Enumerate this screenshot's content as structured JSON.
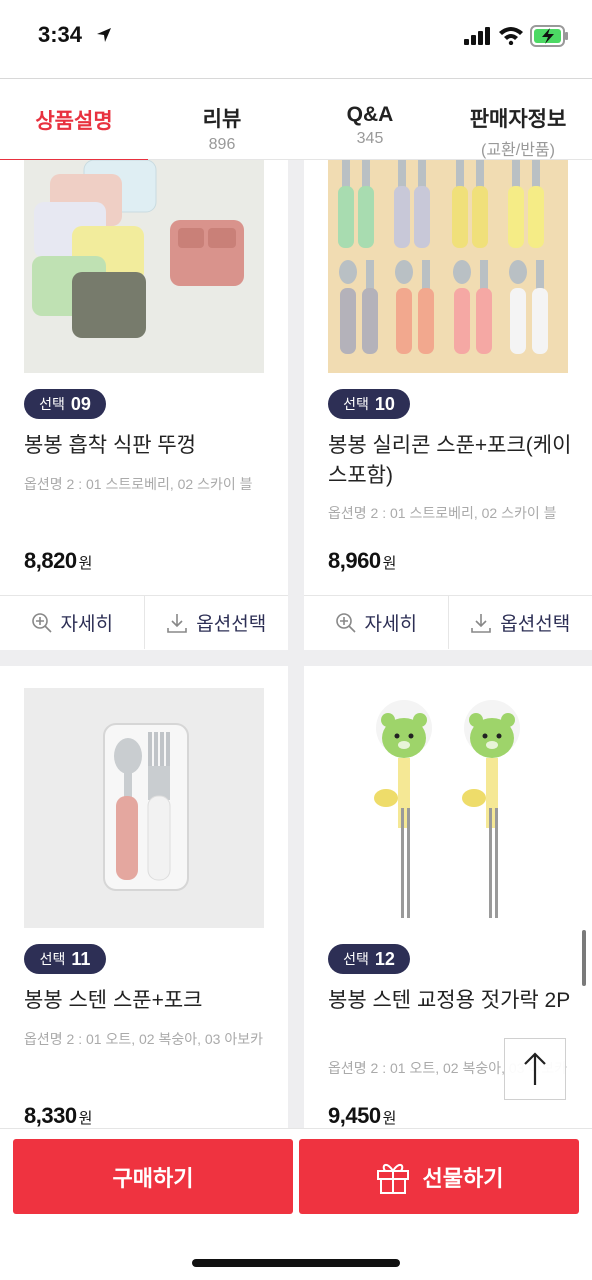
{
  "status": {
    "time": "3:34"
  },
  "tabs": [
    {
      "label": "상품설명",
      "sub": ""
    },
    {
      "label": "리뷰",
      "sub": "896"
    },
    {
      "label": "Q&A",
      "sub": "345"
    },
    {
      "label": "판매자정보",
      "sub": "(교환/반품)"
    }
  ],
  "products": [
    {
      "badge_label": "선택",
      "badge_num": "09",
      "name": "봉봉 흡착 식판 뚜껑",
      "options": "옵션명 2 : 01 스트로베리, 02 스카이 블",
      "price": "8,820",
      "currency": "원"
    },
    {
      "badge_label": "선택",
      "badge_num": "10",
      "name": "봉봉 실리콘 스푼+포크(케이스포함)",
      "options": "옵션명 2 : 01 스트로베리, 02 스카이 블",
      "price": "8,960",
      "currency": "원"
    },
    {
      "badge_label": "선택",
      "badge_num": "11",
      "name": "봉봉 스텐 스푼+포크",
      "options": "옵션명 2 : 01 오트, 02 복숭아, 03 아보카",
      "price": "8,330",
      "currency": "원"
    },
    {
      "badge_label": "선택",
      "badge_num": "12",
      "name": "봉봉 스텐 교정용 젓가락 2P",
      "options": "옵션명 2 : 01 오트, 02 복숭아, 03 아보카",
      "price": "9,450",
      "currency": "원"
    }
  ],
  "actions": {
    "detail": "자세히",
    "option": "옵션선택"
  },
  "bottom": {
    "buy": "구매하기",
    "gift": "선물하기"
  },
  "icons": [
    "location-arrow-icon",
    "signal-icon",
    "wifi-icon",
    "battery-charging-icon",
    "zoom-in-icon",
    "download-icon",
    "arrow-up-icon",
    "gift-icon"
  ],
  "colors": {
    "accent": "#ef3340",
    "badge": "#2d2f55",
    "grid_bg": "#eeeef0"
  }
}
